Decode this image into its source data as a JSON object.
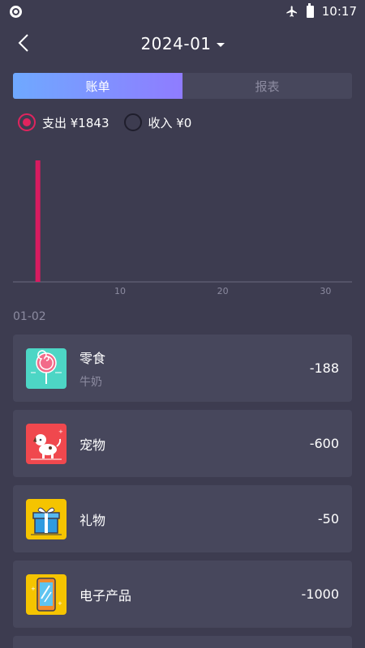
{
  "status_bar": {
    "time": "10:17"
  },
  "header": {
    "month": "2024-01"
  },
  "tabs": [
    {
      "label": "账单",
      "active": true
    },
    {
      "label": "报表",
      "active": false
    }
  ],
  "filters": {
    "expense_label": "支出 ¥1843",
    "income_label": "收入 ¥0",
    "selected": "expense"
  },
  "chart_data": {
    "type": "bar",
    "x": [
      2
    ],
    "values": [
      1843
    ],
    "xlim": [
      1,
      31
    ],
    "x_ticks": [
      "10",
      "20",
      "30"
    ],
    "bar_color": "#d81b60"
  },
  "transactions": {
    "date": "01-02",
    "items": [
      {
        "category": "零食",
        "note": "牛奶",
        "amount": "-188",
        "icon": "lollipop-icon",
        "icon_bg": "#4dd6c5"
      },
      {
        "category": "宠物",
        "note": "",
        "amount": "-600",
        "icon": "dog-icon",
        "icon_bg": "#f0484e"
      },
      {
        "category": "礼物",
        "note": "",
        "amount": "-50",
        "icon": "gift-icon",
        "icon_bg": "#f5c400"
      },
      {
        "category": "电子产品",
        "note": "",
        "amount": "-1000",
        "icon": "phone-icon",
        "icon_bg": "#f5c400"
      }
    ]
  },
  "colors": {
    "background": "#3d3c50",
    "card": "#47475c",
    "accent": "#e0245e",
    "tab_gradient_start": "#6fa9ff",
    "tab_gradient_end": "#8f7cff"
  }
}
